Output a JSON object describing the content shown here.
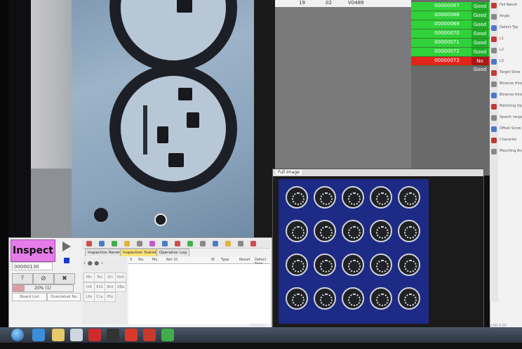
{
  "results": {
    "header_cells": [
      "19",
      "02",
      "V0489"
    ],
    "rows": [
      {
        "id": "00000067",
        "result": "Good",
        "status": "pass"
      },
      {
        "id": "00000068",
        "result": "Good",
        "status": "pass"
      },
      {
        "id": "00000069",
        "result": "Good",
        "status": "pass"
      },
      {
        "id": "00000070",
        "result": "Good",
        "status": "pass"
      },
      {
        "id": "00000071",
        "result": "Good",
        "status": "pass"
      },
      {
        "id": "00000072",
        "result": "Good",
        "status": "pass"
      },
      {
        "id": "00000073",
        "result": "No Good",
        "status": "fail"
      }
    ],
    "colors": {
      "pass": "#2fd23a",
      "fail": "#e2241c"
    }
  },
  "settings": {
    "items": [
      "Fail Result",
      "Angle",
      "Defect Typ",
      "L1",
      "L2",
      "L3",
      "Target Shee",
      "Binarize thre",
      "Binarize thre",
      "Matching Op",
      "Search range",
      "Offset Score",
      "Character",
      "Mounting Accu"
    ]
  },
  "full_image": {
    "title": "Full Image"
  },
  "control": {
    "inspect_label": "Inspect",
    "counter": "00000130",
    "progress_text": "20% (1)",
    "progress_value": 0.2,
    "board_list_label": "Board List",
    "other_label": "Overdetail No",
    "tabs": [
      "Inspection Review",
      "Inspection Statistics",
      "Operation Log"
    ],
    "table_columns": [
      "X",
      "No.",
      "Mu",
      "Ref. ID",
      "W",
      "Type",
      "Result",
      "Defect Type"
    ],
    "nav_labels": [
      "Mis",
      "Tos",
      "Shi",
      "NoS",
      "Inft",
      "ExS",
      "Brd",
      "OBa",
      "LPo",
      "Cl.e",
      "PSc"
    ]
  },
  "taskbar": {
    "product_label": "PRODUCT",
    "clock": "2.00 0.00"
  }
}
